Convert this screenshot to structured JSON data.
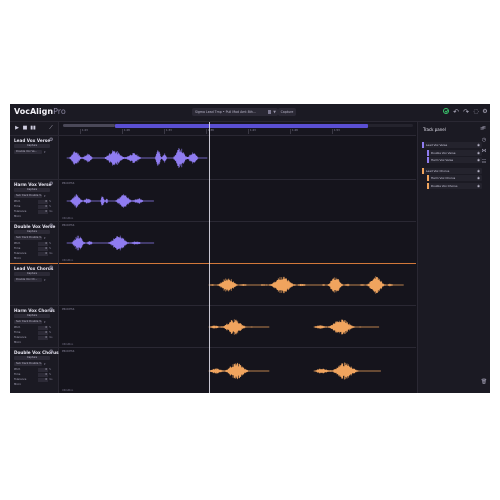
{
  "app": {
    "title": "VocAlign",
    "title_suffix": "Pro"
  },
  "toolbar": {
    "preset": "Sigma Lead Tmp • Pull Mod Amt 8th...",
    "capture_label": "Capture",
    "icons": [
      "status-check-icon",
      "undo-icon",
      "redo-icon",
      "help-icon",
      "gear-icon"
    ]
  },
  "transport": {
    "icons": [
      "play-icon",
      "stop-icon",
      "waveform-icon",
      "link-icon"
    ]
  },
  "ruler": {
    "ticks": [
      "1:23",
      "1:28",
      "1:33",
      "1:38",
      "1:43",
      "1:48",
      "1:53"
    ]
  },
  "tracks": [
    {
      "name": "Lead Vox Verse",
      "role": "Capture",
      "selector": "Double Vox Ve...",
      "params": null,
      "color": "#8f7cf0",
      "lane_label": "",
      "footer": ""
    },
    {
      "name": "Harm Vox Verse",
      "role": "Capture",
      "selector": "Sub track Double V...",
      "params": [
        [
          "Pitch",
          "0",
          "%"
        ],
        [
          "Time",
          "0",
          "%"
        ],
        [
          "Tolerance",
          "0",
          "ms"
        ],
        [
          "Micro",
          "",
          ""
        ]
      ],
      "color": "#8f7cf0",
      "lane_label": "PROCESS",
      "footer": "ORIGINAL"
    },
    {
      "name": "Double Vox Verse",
      "role": "Capture",
      "selector": "Sub track Double V...",
      "params": [
        [
          "Pitch",
          "0",
          "%"
        ],
        [
          "Time",
          "0",
          "%"
        ],
        [
          "Tolerance",
          "0",
          "ms"
        ],
        [
          "Micro",
          "",
          ""
        ]
      ],
      "color": "#8f7cf0",
      "lane_label": "PROCESS",
      "footer": "ORIGINAL"
    },
    {
      "name": "Lead Vox Chorus",
      "role": "Capture",
      "selector": "Double Vox Ch...",
      "params": null,
      "color": "#f0a45e",
      "lane_label": "",
      "footer": ""
    },
    {
      "name": "Harm Vox Chorus",
      "role": "Capture",
      "selector": "Sub track Double V...",
      "params": [
        [
          "Pitch",
          "0",
          "%"
        ],
        [
          "Time",
          "0",
          "%"
        ],
        [
          "Tolerance",
          "0",
          "ms"
        ],
        [
          "Micro",
          "",
          ""
        ]
      ],
      "color": "#f0a45e",
      "lane_label": "PROCESS",
      "footer": "ORIGINAL"
    },
    {
      "name": "Double Vox Chorus",
      "role": "Capture",
      "selector": "Sub track Double V...",
      "params": [
        [
          "Pitch",
          "0",
          "%"
        ],
        [
          "Time",
          "0",
          "%"
        ],
        [
          "Tolerance",
          "0",
          "ms"
        ],
        [
          "Micro",
          "",
          ""
        ]
      ],
      "color": "#f0a45e",
      "lane_label": "PROCESS",
      "footer": "ORIGINAL"
    }
  ],
  "track_panel": {
    "title": "Track panel",
    "items": [
      {
        "name": "Lead Vox Verse",
        "level": 0,
        "color": "#8f7cf0"
      },
      {
        "name": "Double Vox Verse",
        "level": 1,
        "color": "#8f7cf0"
      },
      {
        "name": "Harm Vox Verse",
        "level": 1,
        "color": "#8f7cf0"
      },
      {
        "name": "Lead Vox Chorus",
        "level": 0,
        "color": "#f0a45e"
      },
      {
        "name": "Harm Vox Chorus",
        "level": 1,
        "color": "#f0a45e"
      },
      {
        "name": "Double Vox Chorus",
        "level": 1,
        "color": "#f0a45e"
      }
    ]
  },
  "colors": {
    "verse": "#8f7cf0",
    "chorus": "#f0a45e",
    "region": "#5a4fd2",
    "status": "#39c46c"
  }
}
